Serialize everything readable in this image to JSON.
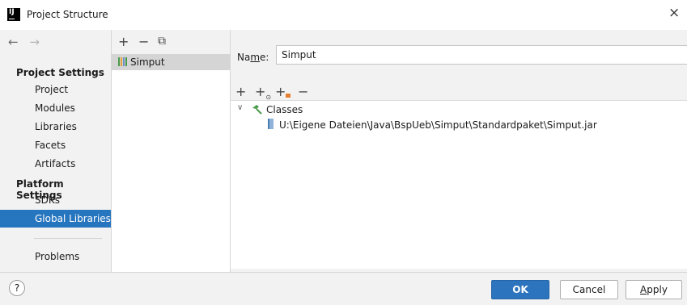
{
  "window": {
    "title": "Project Structure",
    "logo_text": "IJ",
    "close": "×"
  },
  "nav": {
    "back": "←",
    "forward": "→"
  },
  "sidebar": {
    "project_settings_title": "Project Settings",
    "project_items": [
      "Project",
      "Modules",
      "Libraries",
      "Facets",
      "Artifacts"
    ],
    "platform_settings_title": "Platform Settings",
    "platform_items": [
      "SDKs",
      "Global Libraries"
    ],
    "selected_item": "Global Libraries",
    "problems": "Problems"
  },
  "libraries_panel": {
    "toolbar": {
      "add": "+",
      "remove": "−",
      "copy": "⧉"
    },
    "items": [
      "Simput"
    ]
  },
  "details": {
    "name_label_pre": "Na",
    "name_label_mnemonic": "m",
    "name_label_post": "e:",
    "name_value": "Simput",
    "toolbar": {
      "add": "+",
      "add_special": "+",
      "add_special_sub": "⊙",
      "add_jar": "+",
      "remove": "−"
    },
    "tree": {
      "chevron": "∨",
      "classes_label": "Classes",
      "jar_path": "U:\\Eigene Dateien\\Java\\BspUeb\\Simput\\Standardpaket\\Simput.jar"
    }
  },
  "footer": {
    "help": "?",
    "ok": "OK",
    "cancel": "Cancel",
    "apply_mnemonic": "A",
    "apply_rest": "pply"
  },
  "colors": {
    "accent": "#2675bf",
    "ok_button": "#2c74be",
    "library_bars": [
      "#4a9a4a",
      "#e5a33b",
      "#6e8fc7"
    ]
  }
}
